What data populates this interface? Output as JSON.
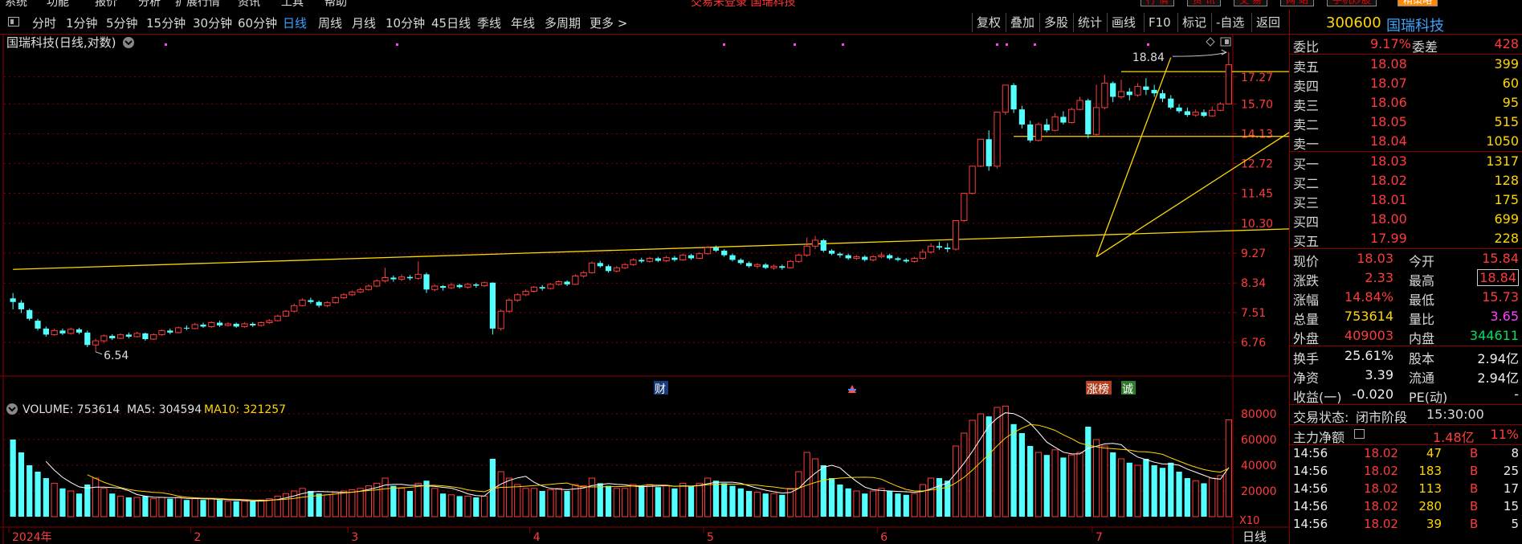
{
  "menubar": {
    "items": [
      "系统",
      "功能",
      "报价",
      "分析",
      "扩展行情",
      "资讯",
      "工具",
      "帮助"
    ],
    "center_title": "交易未登录  国瑞科技",
    "right_buttons": [
      "行 情",
      "资 讯",
      "交 易",
      "网 站",
      "手机炒股",
      "精策略"
    ]
  },
  "toolbar": {
    "periods": [
      "分时",
      "1分钟",
      "5分钟",
      "15分钟",
      "30分钟",
      "60分钟",
      "日线",
      "周线",
      "月线",
      "10分钟",
      "45日线",
      "季线",
      "年线",
      "多周期",
      "更多 >"
    ],
    "active_period": "日线",
    "right_tools": [
      "复权",
      "叠加",
      "多股",
      "统计",
      "画线",
      "F10",
      "标记",
      "-自选",
      "返回"
    ]
  },
  "chart": {
    "title": "国瑞科技(日线,对数)",
    "price_axis": [
      "17.27",
      "15.70",
      "14.13",
      "12.72",
      "11.45",
      "10.30",
      "9.27",
      "8.34",
      "7.51",
      "6.76"
    ],
    "high_annotation": "18.84",
    "low_annotation": "6.54",
    "markers": [
      "财",
      "涨榜",
      "诚"
    ],
    "volume_header": {
      "label": "VOLUME: 753614",
      "ma5": "MA5: 304594",
      "ma10": "MA10: 321257"
    },
    "volume_axis": [
      "80000",
      "60000",
      "40000",
      "20000"
    ],
    "volume_unit": "X10",
    "date_labels": [
      "2024年",
      "2",
      "3",
      "4",
      "5",
      "6",
      "7"
    ],
    "period_label": "日线",
    "colors": {
      "up": "#ff3b3b",
      "down": "#54ffff",
      "line": "#ffd700",
      "grid": "#8a0000",
      "ma5": "#ffffff",
      "ma10": "#ffd700"
    }
  },
  "chart_data": {
    "type": "candlestick",
    "scale": "log",
    "ylim": [
      6.3,
      19.5
    ],
    "volume_ylim": [
      0,
      90000
    ],
    "candles": [
      [
        7.9,
        7.8,
        8.05,
        7.6,
        60000
      ],
      [
        7.78,
        7.6,
        7.85,
        7.5,
        50000
      ],
      [
        7.58,
        7.35,
        7.62,
        7.3,
        40000
      ],
      [
        7.3,
        7.1,
        7.35,
        7.05,
        35000
      ],
      [
        7.1,
        6.95,
        7.15,
        6.9,
        30000
      ],
      [
        6.95,
        7.05,
        7.1,
        6.92,
        26000
      ],
      [
        7.05,
        6.98,
        7.1,
        6.94,
        22000
      ],
      [
        6.98,
        7.08,
        7.12,
        6.95,
        20000
      ],
      [
        7.08,
        7.0,
        7.12,
        6.96,
        18000
      ],
      [
        7.0,
        6.7,
        7.05,
        6.65,
        25000
      ],
      [
        6.7,
        6.8,
        6.85,
        6.54,
        30000
      ],
      [
        6.8,
        6.92,
        6.95,
        6.75,
        22000
      ],
      [
        6.92,
        6.86,
        6.96,
        6.82,
        18000
      ],
      [
        6.86,
        6.95,
        6.98,
        6.84,
        16000
      ],
      [
        6.95,
        6.9,
        7.0,
        6.86,
        15000
      ],
      [
        6.9,
        6.98,
        7.02,
        6.88,
        15000
      ],
      [
        6.98,
        6.84,
        7.0,
        6.8,
        16000
      ],
      [
        6.84,
        6.95,
        6.98,
        6.82,
        14000
      ],
      [
        6.95,
        7.05,
        7.08,
        6.92,
        15000
      ],
      [
        7.05,
        7.0,
        7.1,
        6.96,
        14000
      ],
      [
        7.0,
        7.12,
        7.15,
        6.98,
        15000
      ],
      [
        7.12,
        7.1,
        7.18,
        7.06,
        13000
      ],
      [
        7.1,
        7.2,
        7.24,
        7.08,
        14000
      ],
      [
        7.2,
        7.15,
        7.25,
        7.12,
        13000
      ],
      [
        7.15,
        7.25,
        7.28,
        7.12,
        14000
      ],
      [
        7.25,
        7.18,
        7.3,
        7.14,
        13000
      ],
      [
        7.18,
        7.22,
        7.26,
        7.15,
        12000
      ],
      [
        7.22,
        7.15,
        7.25,
        7.12,
        12000
      ],
      [
        7.15,
        7.22,
        7.26,
        7.12,
        12000
      ],
      [
        7.22,
        7.18,
        7.26,
        7.14,
        12000
      ],
      [
        7.18,
        7.25,
        7.28,
        7.15,
        13000
      ],
      [
        7.25,
        7.3,
        7.34,
        7.22,
        14000
      ],
      [
        7.3,
        7.42,
        7.46,
        7.28,
        16000
      ],
      [
        7.42,
        7.55,
        7.58,
        7.4,
        18000
      ],
      [
        7.55,
        7.7,
        7.75,
        7.52,
        20000
      ],
      [
        7.7,
        7.85,
        7.9,
        7.68,
        22000
      ],
      [
        7.85,
        7.8,
        7.92,
        7.75,
        20000
      ],
      [
        7.8,
        7.7,
        7.84,
        7.65,
        18000
      ],
      [
        7.7,
        7.78,
        7.82,
        7.66,
        17000
      ],
      [
        7.78,
        7.92,
        7.96,
        7.75,
        19000
      ],
      [
        7.92,
        8.0,
        8.05,
        7.88,
        20000
      ],
      [
        8.0,
        8.08,
        8.12,
        7.96,
        21000
      ],
      [
        8.08,
        8.15,
        8.2,
        8.05,
        22000
      ],
      [
        8.15,
        8.25,
        8.3,
        8.12,
        24000
      ],
      [
        8.25,
        8.4,
        8.45,
        8.22,
        26000
      ],
      [
        8.4,
        8.5,
        8.8,
        8.36,
        30000
      ],
      [
        8.5,
        8.45,
        8.56,
        8.38,
        24000
      ],
      [
        8.45,
        8.52,
        8.6,
        8.4,
        22000
      ],
      [
        8.52,
        8.48,
        8.58,
        8.42,
        20000
      ],
      [
        8.48,
        8.6,
        9.0,
        8.44,
        26000
      ],
      [
        8.6,
        8.15,
        8.65,
        8.05,
        28000
      ],
      [
        8.15,
        8.25,
        8.3,
        8.1,
        22000
      ],
      [
        8.25,
        8.2,
        8.28,
        8.12,
        18000
      ],
      [
        8.2,
        8.28,
        8.35,
        8.16,
        17000
      ],
      [
        8.28,
        8.22,
        8.32,
        8.18,
        16000
      ],
      [
        8.22,
        8.3,
        8.34,
        8.18,
        16000
      ],
      [
        8.3,
        8.26,
        8.34,
        8.2,
        15000
      ],
      [
        8.26,
        8.35,
        8.38,
        8.22,
        16000
      ],
      [
        8.35,
        7.1,
        8.36,
        6.95,
        45000
      ],
      [
        7.1,
        7.55,
        7.6,
        7.05,
        35000
      ],
      [
        7.55,
        7.85,
        7.9,
        7.5,
        30000
      ],
      [
        7.85,
        8.0,
        8.05,
        7.8,
        25000
      ],
      [
        8.0,
        8.1,
        8.15,
        7.96,
        22000
      ],
      [
        8.1,
        8.22,
        8.25,
        8.06,
        22000
      ],
      [
        8.22,
        8.18,
        8.28,
        8.12,
        20000
      ],
      [
        8.18,
        8.3,
        8.34,
        8.15,
        21000
      ],
      [
        8.3,
        8.38,
        8.42,
        8.26,
        22000
      ],
      [
        8.38,
        8.3,
        8.42,
        8.25,
        20000
      ],
      [
        8.3,
        8.55,
        8.6,
        8.28,
        25000
      ],
      [
        8.55,
        8.65,
        8.7,
        8.5,
        24000
      ],
      [
        8.65,
        8.95,
        9.0,
        8.62,
        30000
      ],
      [
        8.95,
        8.85,
        9.02,
        8.8,
        26000
      ],
      [
        8.85,
        8.7,
        8.9,
        8.65,
        24000
      ],
      [
        8.7,
        8.8,
        8.85,
        8.66,
        22000
      ],
      [
        8.8,
        8.9,
        8.95,
        8.76,
        22000
      ],
      [
        8.9,
        9.05,
        9.1,
        8.86,
        25000
      ],
      [
        9.05,
        9.0,
        9.12,
        8.95,
        24000
      ],
      [
        9.0,
        9.1,
        9.15,
        8.96,
        25000
      ],
      [
        9.1,
        9.02,
        9.15,
        8.98,
        23000
      ],
      [
        9.02,
        9.12,
        9.18,
        8.98,
        24000
      ],
      [
        9.12,
        9.05,
        9.18,
        9.0,
        22000
      ],
      [
        9.05,
        9.2,
        9.25,
        9.02,
        26000
      ],
      [
        9.2,
        9.1,
        9.25,
        9.05,
        24000
      ],
      [
        9.1,
        9.25,
        9.3,
        9.08,
        26000
      ],
      [
        9.25,
        9.45,
        9.5,
        9.22,
        30000
      ],
      [
        9.45,
        9.35,
        9.52,
        9.3,
        28000
      ],
      [
        9.35,
        9.2,
        9.4,
        9.15,
        26000
      ],
      [
        9.2,
        9.05,
        9.25,
        9.0,
        24000
      ],
      [
        9.05,
        8.95,
        9.1,
        8.9,
        22000
      ],
      [
        8.95,
        8.85,
        9.0,
        8.8,
        20000
      ],
      [
        8.85,
        8.9,
        8.95,
        8.78,
        19000
      ],
      [
        8.9,
        8.8,
        8.95,
        8.76,
        18000
      ],
      [
        8.8,
        8.85,
        8.9,
        8.74,
        18000
      ],
      [
        8.85,
        8.8,
        8.9,
        8.74,
        17000
      ],
      [
        8.8,
        9.0,
        9.05,
        8.78,
        22000
      ],
      [
        9.0,
        9.2,
        9.25,
        8.96,
        35000
      ],
      [
        9.2,
        9.5,
        9.8,
        9.15,
        50000
      ],
      [
        9.5,
        9.7,
        9.85,
        9.4,
        45000
      ],
      [
        9.7,
        9.35,
        9.75,
        9.3,
        40000
      ],
      [
        9.35,
        9.25,
        9.4,
        9.2,
        30000
      ],
      [
        9.25,
        9.2,
        9.3,
        9.12,
        25000
      ],
      [
        9.2,
        9.1,
        9.25,
        9.05,
        22000
      ],
      [
        9.1,
        9.15,
        9.2,
        9.05,
        20000
      ],
      [
        9.15,
        9.05,
        9.2,
        9.0,
        18000
      ],
      [
        9.05,
        9.15,
        9.2,
        9.0,
        20000
      ],
      [
        9.15,
        9.2,
        9.3,
        9.1,
        22000
      ],
      [
        9.2,
        9.1,
        9.25,
        9.05,
        20000
      ],
      [
        9.1,
        9.05,
        9.15,
        9.0,
        18000
      ],
      [
        9.05,
        9.0,
        9.1,
        8.95,
        17000
      ],
      [
        9.0,
        9.1,
        9.15,
        8.96,
        18000
      ],
      [
        9.1,
        9.3,
        9.4,
        9.05,
        25000
      ],
      [
        9.3,
        9.5,
        9.6,
        9.25,
        30000
      ],
      [
        9.5,
        9.45,
        9.65,
        9.38,
        30000
      ],
      [
        9.45,
        9.4,
        9.6,
        9.3,
        28000
      ],
      [
        9.4,
        10.4,
        10.4,
        9.35,
        55000
      ],
      [
        10.4,
        11.45,
        11.45,
        10.35,
        65000
      ],
      [
        11.45,
        12.6,
        12.6,
        11.4,
        75000
      ],
      [
        12.6,
        13.86,
        13.86,
        12.55,
        80000
      ],
      [
        13.86,
        12.6,
        14.3,
        12.4,
        78000
      ],
      [
        12.6,
        15.25,
        15.25,
        12.5,
        85000
      ],
      [
        15.25,
        16.78,
        16.78,
        15.1,
        86000
      ],
      [
        16.78,
        15.4,
        16.9,
        15.2,
        72000
      ],
      [
        15.4,
        14.6,
        15.6,
        14.4,
        65000
      ],
      [
        14.6,
        13.8,
        14.8,
        13.7,
        55000
      ],
      [
        13.8,
        14.6,
        14.7,
        13.75,
        50000
      ],
      [
        14.6,
        14.3,
        14.9,
        14.2,
        48000
      ],
      [
        14.3,
        15.0,
        15.2,
        14.25,
        52000
      ],
      [
        15.0,
        14.7,
        15.3,
        14.6,
        46000
      ],
      [
        14.7,
        15.4,
        15.5,
        14.65,
        48000
      ],
      [
        15.4,
        15.9,
        16.1,
        15.35,
        50000
      ],
      [
        15.9,
        14.1,
        16.0,
        13.9,
        70000
      ],
      [
        14.1,
        15.5,
        16.8,
        14.0,
        60000
      ],
      [
        15.5,
        16.9,
        17.4,
        15.4,
        55000
      ],
      [
        16.9,
        16.1,
        17.0,
        15.8,
        50000
      ],
      [
        16.1,
        16.4,
        17.1,
        16.0,
        45000
      ],
      [
        16.4,
        16.2,
        16.6,
        15.9,
        42000
      ],
      [
        16.2,
        16.7,
        16.9,
        16.1,
        40000
      ],
      [
        16.7,
        16.5,
        17.2,
        16.2,
        45000
      ],
      [
        16.5,
        16.3,
        16.8,
        16.1,
        40000
      ],
      [
        16.3,
        16.0,
        16.5,
        15.8,
        38000
      ],
      [
        16.0,
        15.5,
        16.2,
        15.4,
        42000
      ],
      [
        15.5,
        15.3,
        15.7,
        15.2,
        35000
      ],
      [
        15.3,
        15.1,
        15.5,
        15.0,
        30000
      ],
      [
        15.1,
        15.25,
        15.4,
        15.0,
        28000
      ],
      [
        15.25,
        15.05,
        15.4,
        14.98,
        26000
      ],
      [
        15.05,
        15.35,
        15.55,
        15.0,
        30000
      ],
      [
        15.35,
        15.7,
        15.8,
        15.3,
        32000
      ],
      [
        15.7,
        18.03,
        18.84,
        15.73,
        75361
      ]
    ],
    "month_starts": [
      "2024-01",
      "2024-02",
      "2024-03",
      "2024-04",
      "2024-05",
      "2024-06",
      "2024-07"
    ],
    "trendlines": [
      {
        "from_index": 0,
        "from_price": 8.75,
        "to_index": 160,
        "to_price": 10.15
      },
      {
        "from_index": 131,
        "from_price": 9.15,
        "to_index": 140,
        "to_price": 18.5
      },
      {
        "from_index": 131,
        "from_price": 9.15,
        "to_index": 160,
        "to_price": 15.8
      },
      {
        "from_index": 134,
        "from_price": 17.6,
        "to_index": 159,
        "to_price": 17.6
      },
      {
        "from_index": 121,
        "from_price": 14.0,
        "to_index": 159,
        "to_price": 14.0
      }
    ]
  },
  "quote": {
    "code": "300600",
    "name": "国瑞科技",
    "weibi_label": "委比",
    "weibi": "9.17%",
    "weicha_label": "委差",
    "weicha": "428",
    "asks": [
      {
        "label": "卖五",
        "price": "18.08",
        "vol": "399"
      },
      {
        "label": "卖四",
        "price": "18.07",
        "vol": "60"
      },
      {
        "label": "卖三",
        "price": "18.06",
        "vol": "95"
      },
      {
        "label": "卖二",
        "price": "18.05",
        "vol": "515"
      },
      {
        "label": "卖一",
        "price": "18.04",
        "vol": "1050"
      }
    ],
    "bids": [
      {
        "label": "买一",
        "price": "18.03",
        "vol": "1317"
      },
      {
        "label": "买二",
        "price": "18.02",
        "vol": "128"
      },
      {
        "label": "买三",
        "price": "18.01",
        "vol": "175"
      },
      {
        "label": "买四",
        "price": "18.00",
        "vol": "699"
      },
      {
        "label": "买五",
        "price": "17.99",
        "vol": "228"
      }
    ],
    "stats1": [
      {
        "l1": "现价",
        "v1": "18.03",
        "c1": "red",
        "l2": "今开",
        "v2": "15.84",
        "c2": "red"
      },
      {
        "l1": "涨跌",
        "v1": "2.33",
        "c1": "red",
        "l2": "最高",
        "v2": "18.84",
        "c2": "red"
      },
      {
        "l1": "涨幅",
        "v1": "14.84%",
        "c1": "red",
        "l2": "最低",
        "v2": "15.73",
        "c2": "red"
      },
      {
        "l1": "总量",
        "v1": "753614",
        "c1": "yellow",
        "l2": "量比",
        "v2": "3.65",
        "c2": "mag"
      },
      {
        "l1": "外盘",
        "v1": "409003",
        "c1": "red",
        "l2": "内盘",
        "v2": "344611",
        "c2": "green"
      }
    ],
    "stats2": [
      {
        "l1": "换手",
        "v1": "25.61%",
        "c1": "white",
        "l2": "股本",
        "v2": "2.94亿",
        "c2": "white"
      },
      {
        "l1": "净资",
        "v1": "3.39",
        "c1": "white",
        "l2": "流通",
        "v2": "2.94亿",
        "c2": "white"
      },
      {
        "l1": "收益(一)",
        "v1": "-0.020",
        "c1": "white",
        "l2": "PE(动)",
        "v2": "-",
        "c2": "white"
      }
    ],
    "status_label": "交易状态:",
    "status_value": "闭市阶段",
    "status_time": "15:30:00",
    "net_label": "主力净额",
    "net_value": "1.48亿",
    "net_pct": "11%",
    "ticks": [
      {
        "time": "14:56",
        "price": "18.02",
        "vol": "47",
        "side": "B",
        "n": "8"
      },
      {
        "time": "14:56",
        "price": "18.02",
        "vol": "183",
        "side": "B",
        "n": "25"
      },
      {
        "time": "14:56",
        "price": "18.02",
        "vol": "113",
        "side": "B",
        "n": "17"
      },
      {
        "time": "14:56",
        "price": "18.02",
        "vol": "280",
        "side": "B",
        "n": "15"
      },
      {
        "time": "14:56",
        "price": "18.02",
        "vol": "39",
        "side": "B",
        "n": "5"
      }
    ]
  }
}
